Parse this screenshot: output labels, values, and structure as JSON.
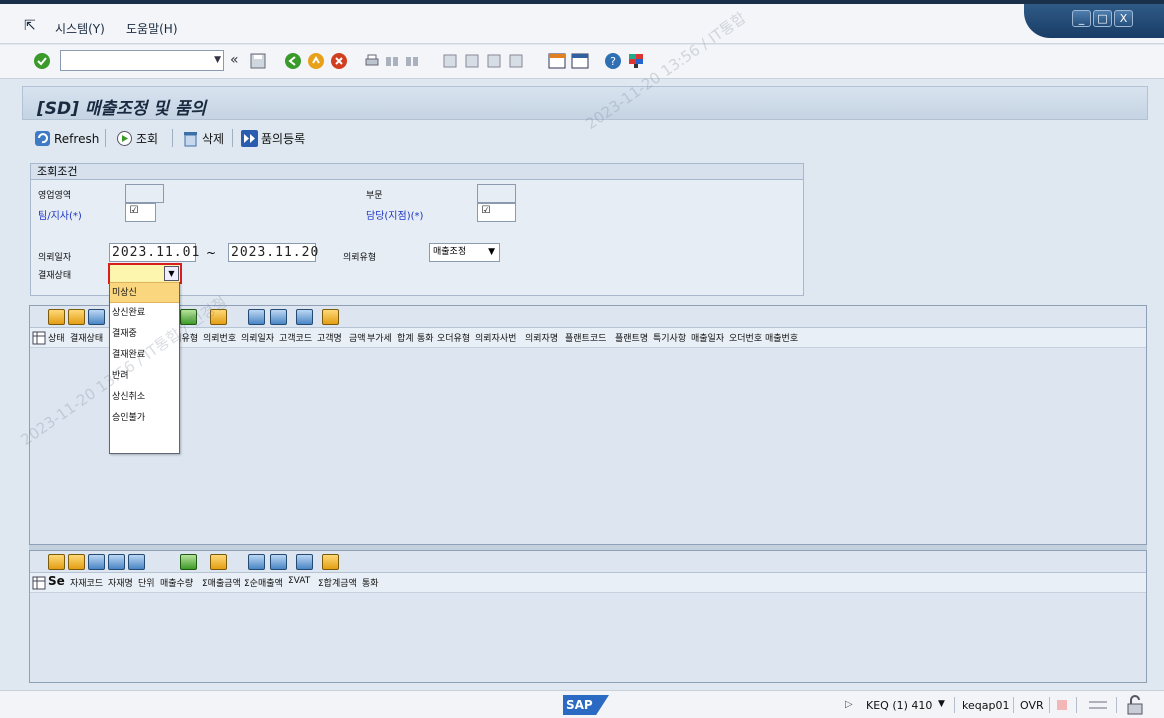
{
  "menu": {
    "system": "시스템(Y)",
    "help": "도움말(H)"
  },
  "window_controls": {
    "minimize": "_",
    "maximize": "□",
    "close": "X"
  },
  "okcode": {
    "value": ""
  },
  "title": "[SD] 매출조정 및 품의",
  "app_toolbar": {
    "refresh": "Refresh",
    "search": "조회",
    "delete": "삭제",
    "register": "품의등록"
  },
  "criteria": {
    "header": "조회조건",
    "sales_area_label": "영업영역",
    "division_label": "부문",
    "team_label": "팀/지사(*)",
    "owner_label": "담당(지점)(*)",
    "team_checkmark": "☑",
    "owner_checkmark": "☑",
    "date_label": "의뢰일자",
    "date_from": "2023.11.01",
    "date_sep": "~",
    "date_to": "2023.11.20",
    "request_type_label": "의뢰유형",
    "request_type_value": "매출조정",
    "approval_status_label": "결재상태",
    "approval_status_value": ""
  },
  "approval_dropdown": {
    "options": [
      "미상신",
      "상신완료",
      "결재중",
      "결재완료",
      "반려",
      "상신취소",
      "승인불가"
    ],
    "highlighted": "미상신"
  },
  "grid_top": {
    "columns": [
      "상태",
      "결재상태",
      "결재자",
      "의뢰유형",
      "의뢰번호",
      "의뢰일자",
      "고객코드",
      "고객명",
      "금액",
      "부가세",
      "합계",
      "통화",
      "오더유형",
      "의뢰자사번",
      "의뢰자명",
      "플랜트코드",
      "플랜트명",
      "특기사항",
      "매출일자",
      "오더번호",
      "매출번호"
    ]
  },
  "grid_bottom": {
    "columns": [
      "Se",
      "자재코드",
      "자재명",
      "단위",
      "매출수량",
      "Σ매출금액",
      "Σ순매출액",
      "ΣVAT",
      "Σ합계금액",
      "통화"
    ]
  },
  "status_bar": {
    "system": "KEQ (1) 410",
    "user": "keqap01",
    "mode": "OVR",
    "logo": "SAP"
  },
  "watermark": {
    "text1": "2023-11-20 13:56 / IT통합",
    "text2": "2023-11-20 13:56 / IT통합 / 민경철"
  },
  "colors": {
    "title_bg": "#c5d3e3",
    "selected_field": "#fdf6ae",
    "highlight_item": "#fad67e",
    "label_blue": "#1c34c4"
  }
}
